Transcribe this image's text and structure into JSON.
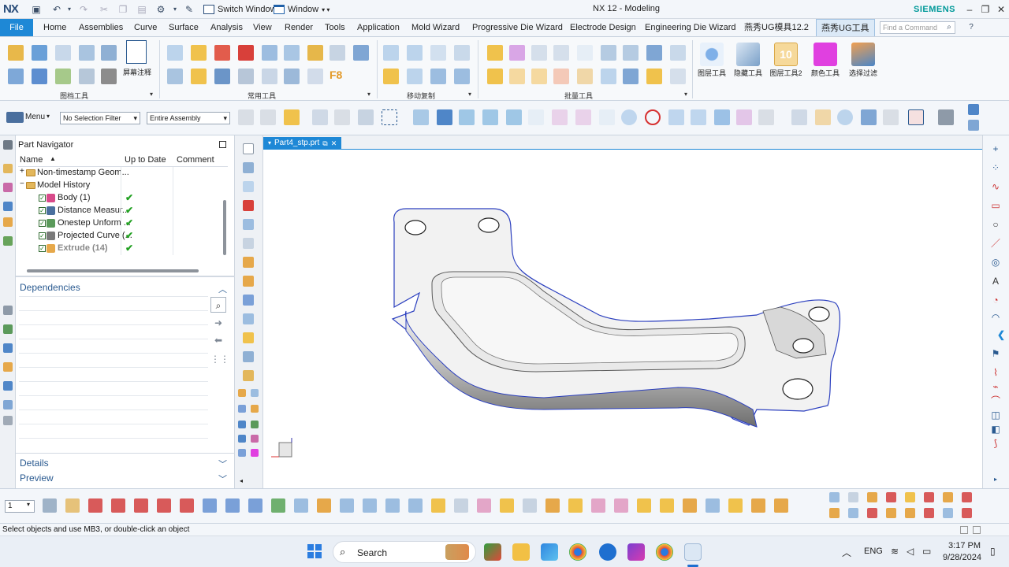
{
  "titlebar": {
    "logo": "NX",
    "switch_window": "Switch Window",
    "window_menu": "Window",
    "title": "NX 12 - Modeling",
    "brand": "SIEMENS"
  },
  "menu": {
    "file": "File",
    "tabs": [
      "Home",
      "Assemblies",
      "Curve",
      "Surface",
      "Analysis",
      "View",
      "Render",
      "Tools",
      "Application",
      "Mold Wizard",
      "Progressive Die Wizard",
      "Electrode Design",
      "Engineering Die Wizard",
      "燕秀UG模具12.2",
      "燕秀UG工具"
    ],
    "active_tab": "燕秀UG工具",
    "find_placeholder": "Find a Command"
  },
  "ribbon": {
    "groups": [
      "图档工具",
      "常用工具",
      "移动复制",
      "批量工具"
    ],
    "screen_note": "屏幕注释",
    "big_buttons": [
      {
        "label": "图层工具",
        "color": "#5a8fd4"
      },
      {
        "label": "隐藏工具",
        "color": "#7aa0c8"
      },
      {
        "label": "图层工具2",
        "color": "#f0c070"
      },
      {
        "label": "颜色工具",
        "color": "#e040e0"
      },
      {
        "label": "选择过滤",
        "color": "#e07a30"
      }
    ],
    "big_badge": "10",
    "f8_label": "F8"
  },
  "toolbar2": {
    "menu": "Menu",
    "selection_filter": "No Selection Filter",
    "scope": "Entire Assembly"
  },
  "navigator": {
    "title": "Part Navigator",
    "columns": [
      "Name",
      "Up to Date",
      "Comment"
    ],
    "rows": [
      {
        "name": "Non-timestamp Geom...",
        "type": "folder",
        "expander": "+",
        "ok": false
      },
      {
        "name": "Model History",
        "type": "folder",
        "expander": "−",
        "ok": false
      },
      {
        "name": "Body (1)",
        "type": "feature",
        "ok": true
      },
      {
        "name": "Distance Measur...",
        "type": "feature",
        "ok": true
      },
      {
        "name": "Onestep Unform ...",
        "type": "feature",
        "ok": true
      },
      {
        "name": "Projected Curve (...",
        "type": "feature",
        "ok": true
      },
      {
        "name": "Extrude (14)",
        "type": "feature",
        "ok": true
      }
    ],
    "dependencies": "Dependencies",
    "details": "Details",
    "preview": "Preview"
  },
  "graphics": {
    "tab": "Part4_stp.prt",
    "part_color": "#f2f2f2",
    "edge_color": "#2b3fbf"
  },
  "bottombar": {
    "layer": "1"
  },
  "status": {
    "message": "Select objects and use MB3, or double-click an object"
  },
  "taskbar": {
    "search": "Search",
    "lang": "ENG",
    "time": "3:17 PM",
    "date": "9/28/2024"
  }
}
